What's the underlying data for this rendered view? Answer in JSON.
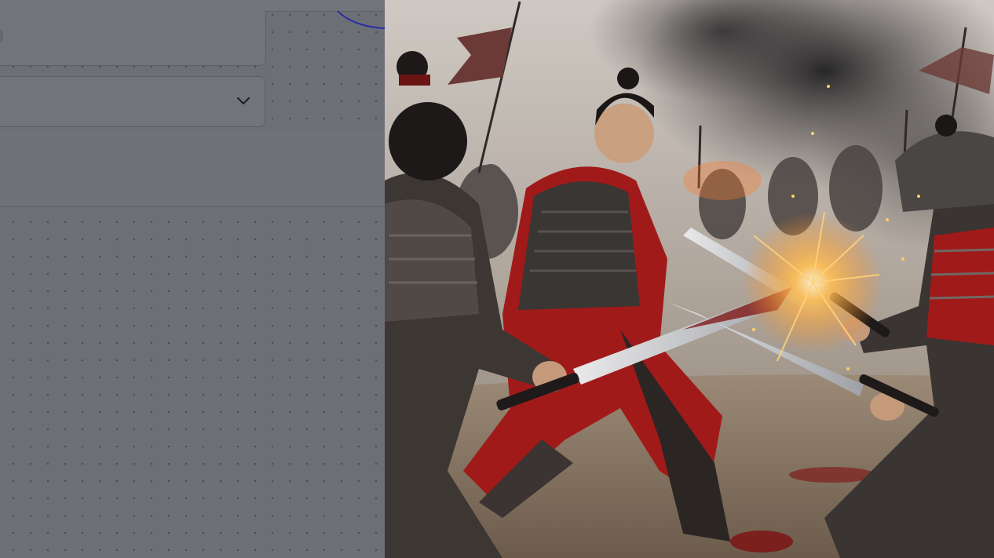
{
  "editor": {
    "text_field": {
      "value": "",
      "placeholder": ""
    },
    "select_field": {
      "selected": "",
      "icon": "chevron-down-icon"
    },
    "section": {
      "label": ""
    }
  },
  "image": {
    "subject": "",
    "palette": {
      "smoke": "#2b2a2c",
      "sky": "#d9d4cf",
      "armor_red": "#a11a1a",
      "armor_dark": "#3a3634",
      "ground": "#8c7a66",
      "spark": "#ffd27a"
    }
  },
  "colors": {
    "canvas_bg": "#6d6f76",
    "connector": "#2c2fa3"
  }
}
